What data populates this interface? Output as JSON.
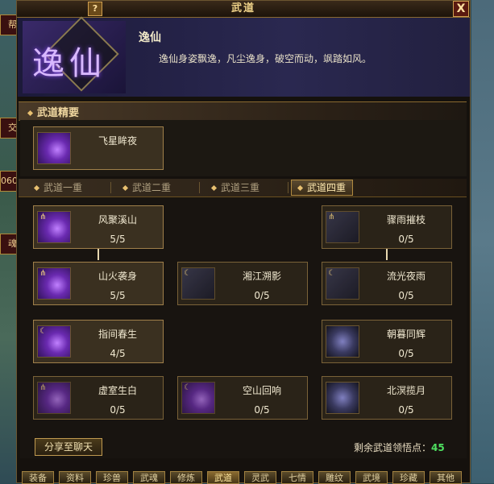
{
  "window": {
    "title": "武道",
    "help": "?",
    "close": "X"
  },
  "side": [
    "帮会",
    "交易",
    "060",
    "魂"
  ],
  "header": {
    "emblem": "逸仙",
    "name": "逸仙",
    "desc": "逸仙身姿飘逸，凡尘逸身，破空而动，飒踏如风。"
  },
  "essence": {
    "heading": "武道精要",
    "skill": {
      "name": "飞星眸夜"
    }
  },
  "tabs": [
    "武道一重",
    "武道二重",
    "武道三重",
    "武道四重"
  ],
  "active_tab": "武道四重",
  "skills": [
    {
      "name": "风聚溪山",
      "level": "5/5"
    },
    {
      "name": "骤雨摧枝",
      "level": "0/5"
    },
    {
      "name": "山火袭身",
      "level": "5/5"
    },
    {
      "name": "湘江溯影",
      "level": "0/5"
    },
    {
      "name": "流光夜雨",
      "level": "0/5"
    },
    {
      "name": "指间春生",
      "level": "4/5"
    },
    {
      "name": "朝暮同辉",
      "level": "0/5"
    },
    {
      "name": "虚室生白",
      "level": "0/5"
    },
    {
      "name": "空山回响",
      "level": "0/5"
    },
    {
      "name": "北溟揽月",
      "level": "0/5"
    }
  ],
  "footer": {
    "share": "分享至聊天",
    "points_label": "剩余武道领悟点：",
    "points_value": "45"
  },
  "bottom_tabs": [
    "装备",
    "资料",
    "珍兽",
    "武魂",
    "修炼",
    "武道",
    "灵武",
    "七情",
    "雕纹",
    "武境",
    "珍藏",
    "其他"
  ],
  "active_bottom_tab": "武道"
}
